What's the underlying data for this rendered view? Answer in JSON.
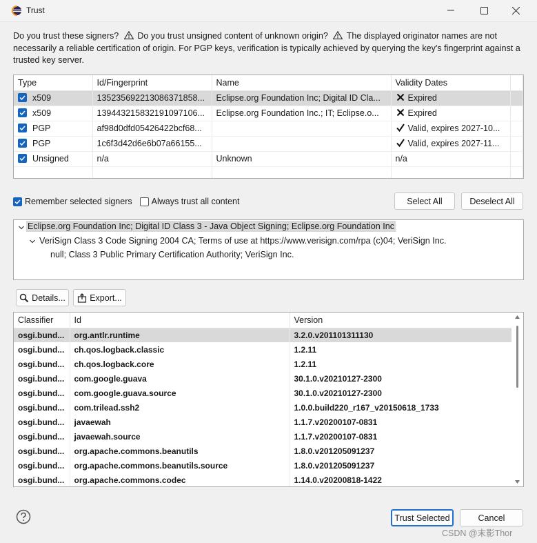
{
  "window": {
    "title": "Trust"
  },
  "intro": {
    "part1": "Do you trust these signers?",
    "part2": "Do you trust unsigned content of unknown origin?",
    "part3": "The displayed originator names are not necessarily a reliable certification of origin.  For PGP keys, verification is typically achieved by querying the key's fingerprint against a trusted key server."
  },
  "signers": {
    "columns": [
      "Type",
      "Id/Fingerprint",
      "Name",
      "Validity Dates"
    ],
    "rows": [
      {
        "type": "x509",
        "id": "135235692213086371858...",
        "name": "Eclipse.org Foundation Inc; Digital ID Cla...",
        "validity": "Expired",
        "validity_icon": "x-icon",
        "checked": true,
        "selected": true
      },
      {
        "type": "x509",
        "id": "139443215832191097106...",
        "name": "Eclipse.org Foundation Inc.; IT; Eclipse.o...",
        "validity": "Expired",
        "validity_icon": "x-icon",
        "checked": true,
        "selected": false
      },
      {
        "type": "PGP",
        "id": "af98d0dfd05426422bcf68...",
        "name": "",
        "validity": "Valid, expires 2027-10...",
        "validity_icon": "check-icon",
        "checked": true,
        "selected": false
      },
      {
        "type": "PGP",
        "id": "1c6f3d42d6e6b07a66155...",
        "name": "",
        "validity": "Valid, expires 2027-11...",
        "validity_icon": "check-icon",
        "checked": true,
        "selected": false
      },
      {
        "type": "Unsigned",
        "id": "n/a",
        "name": "Unknown",
        "validity": "n/a",
        "validity_icon": "",
        "checked": true,
        "selected": false
      }
    ]
  },
  "options": {
    "remember_label": "Remember selected signers",
    "remember_checked": true,
    "always_trust_label": "Always trust all content",
    "always_trust_checked": false,
    "select_all": "Select All",
    "deselect_all": "Deselect All"
  },
  "cert_tree": {
    "root": "Eclipse.org Foundation Inc; Digital ID Class 3 - Java Object Signing; Eclipse.org Foundation Inc",
    "child": "VeriSign Class 3 Code Signing 2004 CA; Terms of use at https://www.verisign.com/rpa (c)04; VeriSign Inc.",
    "grandchild": "null; Class 3 Public Primary Certification Authority; VeriSign Inc."
  },
  "actions": {
    "details": "Details...",
    "export": "Export..."
  },
  "bundles": {
    "columns": [
      "Classifier",
      "Id",
      "Version"
    ],
    "rows": [
      {
        "classifier": "osgi.bund...",
        "id": "org.antlr.runtime",
        "version": "3.2.0.v201101311130"
      },
      {
        "classifier": "osgi.bund...",
        "id": "ch.qos.logback.classic",
        "version": "1.2.11"
      },
      {
        "classifier": "osgi.bund...",
        "id": "ch.qos.logback.core",
        "version": "1.2.11"
      },
      {
        "classifier": "osgi.bund...",
        "id": "com.google.guava",
        "version": "30.1.0.v20210127-2300"
      },
      {
        "classifier": "osgi.bund...",
        "id": "com.google.guava.source",
        "version": "30.1.0.v20210127-2300"
      },
      {
        "classifier": "osgi.bund...",
        "id": "com.trilead.ssh2",
        "version": "1.0.0.build220_r167_v20150618_1733"
      },
      {
        "classifier": "osgi.bund...",
        "id": "javaewah",
        "version": "1.1.7.v20200107-0831"
      },
      {
        "classifier": "osgi.bund...",
        "id": "javaewah.source",
        "version": "1.1.7.v20200107-0831"
      },
      {
        "classifier": "osgi.bund...",
        "id": "org.apache.commons.beanutils",
        "version": "1.8.0.v201205091237"
      },
      {
        "classifier": "osgi.bund...",
        "id": "org.apache.commons.beanutils.source",
        "version": "1.8.0.v201205091237"
      },
      {
        "classifier": "osgi.bund...",
        "id": "org.apache.commons.codec",
        "version": "1.14.0.v20200818-1422"
      }
    ]
  },
  "footer": {
    "trust_selected": "Trust Selected",
    "cancel": "Cancel",
    "watermark": "CSDN @末影Thor"
  },
  "colors": {
    "checkbox": "#1565c0",
    "selection": "#d9d9d9",
    "primary_border": "#1f6fd1"
  }
}
